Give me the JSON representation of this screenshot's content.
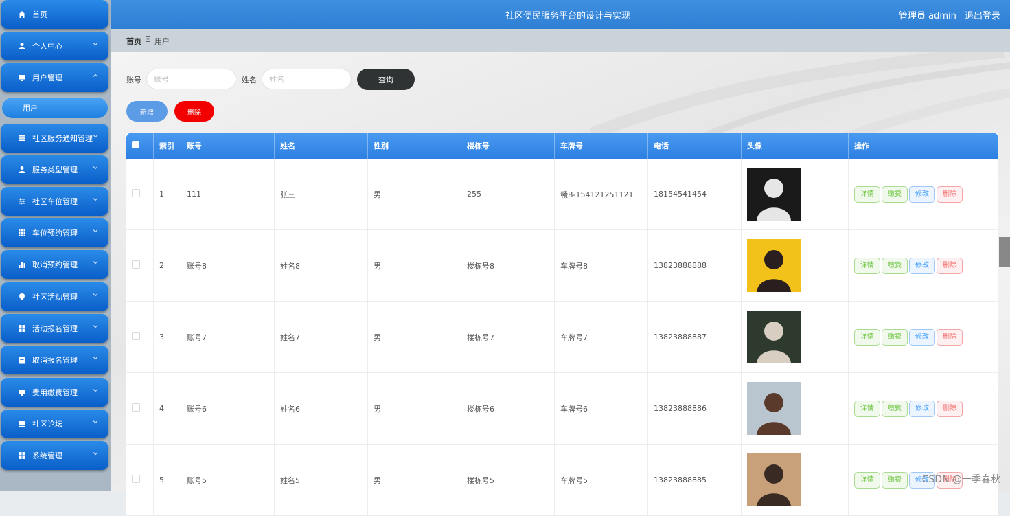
{
  "sidebar": {
    "items": [
      {
        "label": "首页",
        "icon": "home-icon",
        "chevron": ""
      },
      {
        "label": "个人中心",
        "icon": "person-icon",
        "chevron": "down"
      },
      {
        "label": "用户管理",
        "icon": "monitor-icon",
        "chevron": "up"
      },
      {
        "label": "社区服务通知管理",
        "icon": "list-icon",
        "chevron": "down"
      },
      {
        "label": "服务类型管理",
        "icon": "person-icon",
        "chevron": "down"
      },
      {
        "label": "社区车位管理",
        "icon": "sliders-icon",
        "chevron": "down"
      },
      {
        "label": "车位预约管理",
        "icon": "grid-icon",
        "chevron": "down"
      },
      {
        "label": "取消预约管理",
        "icon": "bar-chart-icon",
        "chevron": "down"
      },
      {
        "label": "社区活动管理",
        "icon": "location-icon",
        "chevron": "down"
      },
      {
        "label": "活动报名管理",
        "icon": "apps-icon",
        "chevron": "down"
      },
      {
        "label": "取消报名管理",
        "icon": "clipboard-icon",
        "chevron": "down"
      },
      {
        "label": "费用缴费管理",
        "icon": "payment-icon",
        "chevron": "down"
      },
      {
        "label": "社区论坛",
        "icon": "forum-icon",
        "chevron": "down"
      },
      {
        "label": "系统管理",
        "icon": "apps-icon",
        "chevron": "down"
      }
    ],
    "sub_item": "用户"
  },
  "header": {
    "title": "社区便民服务平台的设计与实现",
    "user_label": "管理员 admin",
    "logout": "退出登录"
  },
  "breadcrumb": {
    "home": "首页",
    "separator": "Ξ",
    "current": "用户"
  },
  "search": {
    "account_label": "账号",
    "account_placeholder": "账号",
    "name_label": "姓名",
    "name_placeholder": "姓名",
    "query_button": "查询"
  },
  "actions": {
    "add": "新增",
    "delete": "删除"
  },
  "table": {
    "headers": [
      "索引",
      "账号",
      "姓名",
      "性别",
      "楼栋号",
      "车牌号",
      "电话",
      "头像",
      "操作"
    ],
    "rows": [
      {
        "index": "1",
        "account": "111",
        "name": "张三",
        "gender": "男",
        "building": "255",
        "plate": "赣B-154121251121",
        "phone": "18154541454",
        "avatar_colors": [
          "#1a1a1a",
          "#e6e6e6"
        ]
      },
      {
        "index": "2",
        "account": "账号8",
        "name": "姓名8",
        "gender": "男",
        "building": "楼栋号8",
        "plate": "车牌号8",
        "phone": "13823888888",
        "avatar_colors": [
          "#f2c11a",
          "#2a1e1e"
        ]
      },
      {
        "index": "3",
        "account": "账号7",
        "name": "姓名7",
        "gender": "男",
        "building": "楼栋号7",
        "plate": "车牌号7",
        "phone": "13823888887",
        "avatar_colors": [
          "#2f3a2e",
          "#d8cfc2"
        ]
      },
      {
        "index": "4",
        "account": "账号6",
        "name": "姓名6",
        "gender": "男",
        "building": "楼栋号6",
        "plate": "车牌号6",
        "phone": "13823888886",
        "avatar_colors": [
          "#b9c6cf",
          "#5a3a2a"
        ]
      },
      {
        "index": "5",
        "account": "账号5",
        "name": "姓名5",
        "gender": "男",
        "building": "楼栋号5",
        "plate": "车牌号5",
        "phone": "13823888885",
        "avatar_colors": [
          "#c8a07a",
          "#3a2a24"
        ]
      }
    ],
    "ops": {
      "detail": "详情",
      "pay": "缴费",
      "edit": "修改",
      "remove": "删除"
    }
  },
  "watermark": "CSDN @一季春秋"
}
